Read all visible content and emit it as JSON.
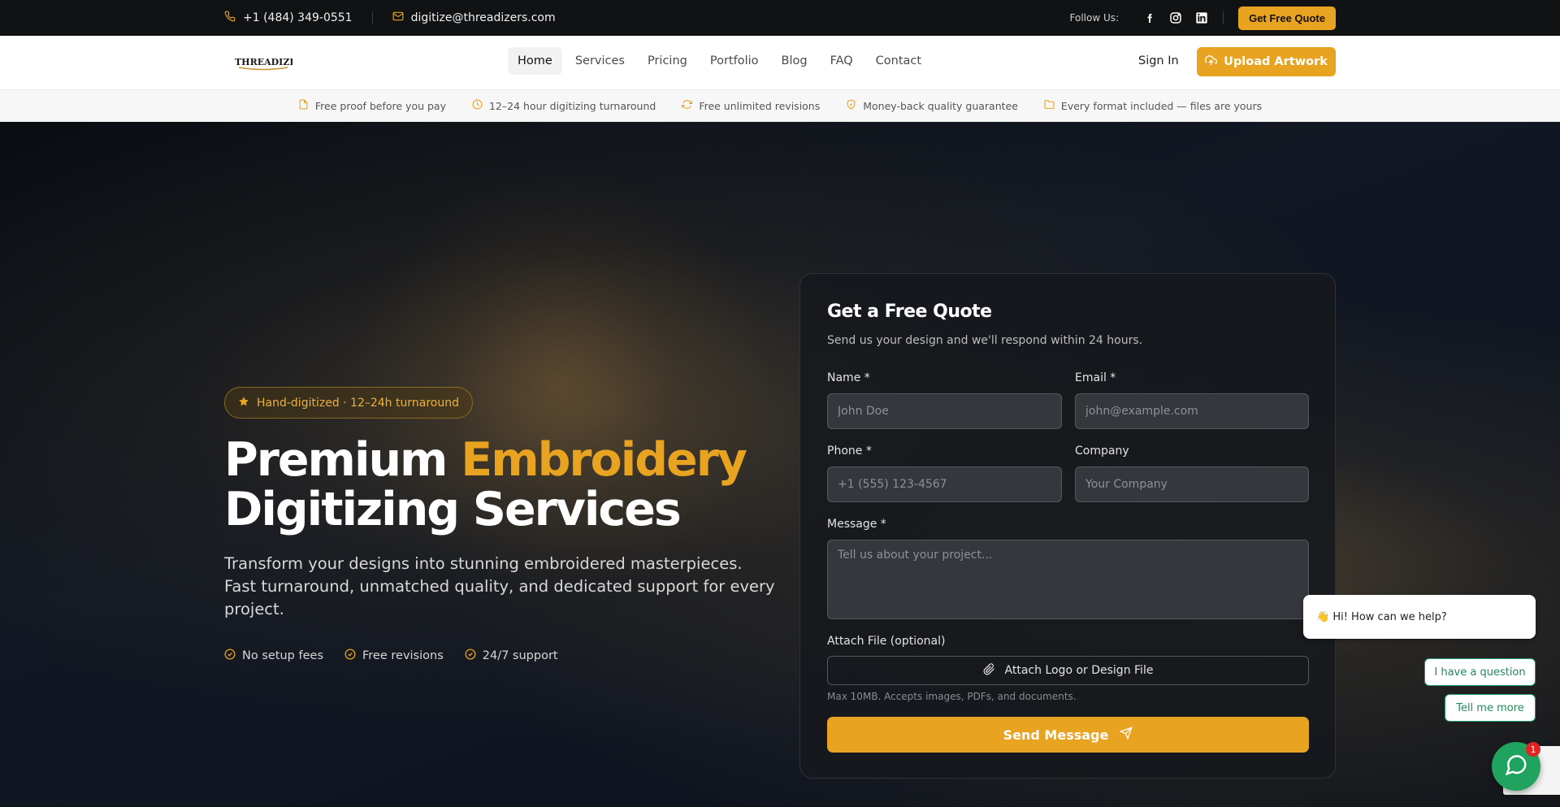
{
  "topbar": {
    "phone": "+1 (484) 349-0551",
    "email": "digitize@threadizers.com",
    "follow_label": "Follow Us:",
    "socials": [
      "facebook-icon",
      "instagram-icon",
      "linkedin-icon"
    ],
    "quote_button": "Get Free Quote"
  },
  "nav": {
    "logo_alt": "Threadizers",
    "items": [
      "Home",
      "Services",
      "Pricing",
      "Portfolio",
      "Blog",
      "FAQ",
      "Contact"
    ],
    "active": "Home",
    "sign_in": "Sign In",
    "upload_button": "Upload Artwork"
  },
  "features": [
    {
      "icon": "file-icon",
      "label": "Free proof before you pay"
    },
    {
      "icon": "clock-icon",
      "label": "12–24 hour digitizing turnaround"
    },
    {
      "icon": "refresh-icon",
      "label": "Free unlimited revisions"
    },
    {
      "icon": "shield-check-icon",
      "label": "Money-back quality guarantee"
    },
    {
      "icon": "folder-icon",
      "label": "Every format included — files are yours"
    }
  ],
  "hero": {
    "pill": "Hand-digitized · 12–24h turnaround",
    "headline_1": "Premium ",
    "headline_accent": "Embroidery",
    "headline_2": "Digitizing Services",
    "subtitle": "Transform your designs into stunning embroidered masterpieces. Fast turnaround, unmatched quality, and dedicated support for every project.",
    "checks": [
      "No setup fees",
      "Free revisions",
      "24/7 support"
    ]
  },
  "form": {
    "title": "Get a Free Quote",
    "description": "Send us your design and we'll respond within 24 hours.",
    "name_label": "Name *",
    "name_placeholder": "John Doe",
    "email_label": "Email *",
    "email_placeholder": "john@example.com",
    "phone_label": "Phone *",
    "phone_placeholder": "+1 (555) 123-4567",
    "company_label": "Company",
    "company_placeholder": "Your Company",
    "message_label": "Message *",
    "message_placeholder": "Tell us about your project...",
    "attach_label": "Attach File (optional)",
    "attach_button": "Attach Logo or Design File",
    "attach_hint": "Max 10MB. Accepts images, PDFs, and documents.",
    "send_button": "Send Message"
  },
  "chat": {
    "greeting": "👋 Hi! How can we help?",
    "options": [
      "I have a question",
      "Tell me more"
    ],
    "badge": "1"
  },
  "colors": {
    "accent": "#e8a320",
    "topbar": "#111214",
    "chat_green": "#1fa35e"
  }
}
